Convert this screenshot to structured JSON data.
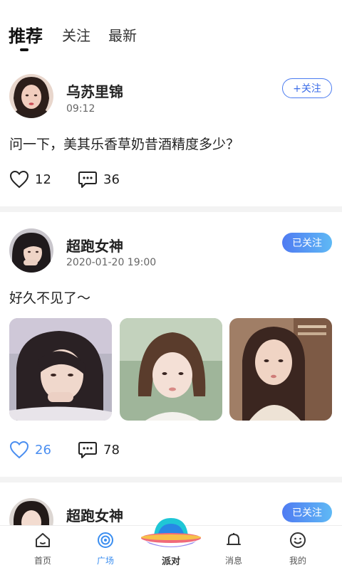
{
  "tabs": [
    {
      "label": "推荐",
      "active": true
    },
    {
      "label": "关注",
      "active": false
    },
    {
      "label": "最新",
      "active": false
    }
  ],
  "posts": [
    {
      "author": "乌苏里锦",
      "time": "09:12",
      "follow_label": "+关注",
      "follow_state": "not-followed",
      "content": "问一下，美其乐香草奶昔酒精度多少？",
      "likes": "12",
      "comments": "36",
      "liked": false
    },
    {
      "author": "超跑女神",
      "time": "2020-01-20 19:00",
      "follow_label": "已关注",
      "follow_state": "followed",
      "content": "好久不见了～",
      "likes": "26",
      "comments": "78",
      "liked": true,
      "image_count": 3
    },
    {
      "author": "超跑女神",
      "follow_label": "已关注",
      "follow_state": "followed"
    }
  ],
  "bottom_nav": [
    {
      "label": "首页",
      "icon": "home-icon",
      "active": false
    },
    {
      "label": "广场",
      "icon": "square-icon",
      "active": true
    },
    {
      "label": "派对",
      "icon": "party-icon",
      "active": false
    },
    {
      "label": "消息",
      "icon": "bell-icon",
      "active": false
    },
    {
      "label": "我的",
      "icon": "smile-icon",
      "active": false
    }
  ],
  "colors": {
    "accent": "#3b8ef0",
    "follow_border": "#4a7bf0",
    "liked": "#4a8ef0"
  }
}
